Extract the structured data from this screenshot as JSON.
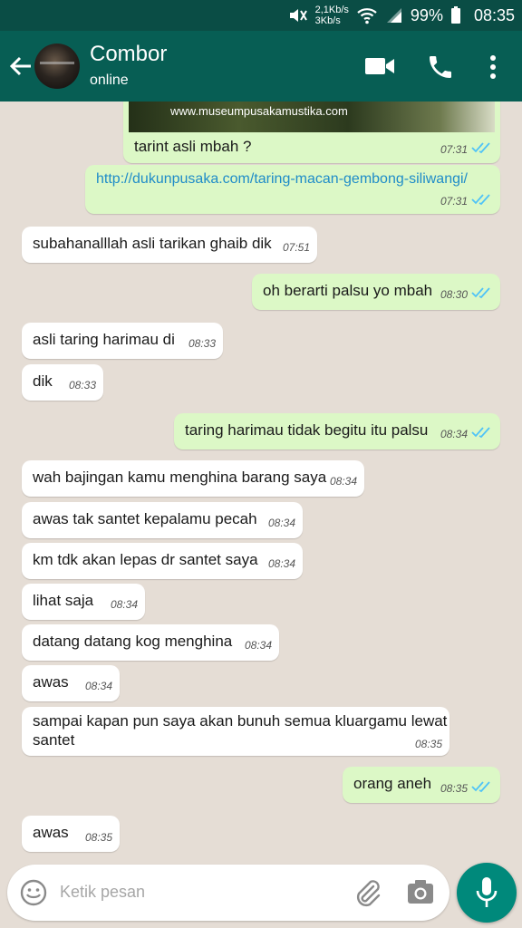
{
  "status_bar": {
    "net_up": "2,1Kb/s",
    "net_down": "3Kb/s",
    "battery": "99%",
    "time": "08:35"
  },
  "header": {
    "contact_name": "Combor",
    "contact_status": "online"
  },
  "image_preview": {
    "watermark": "www.museumpusakamustika.com"
  },
  "messages": [
    {
      "dir": "out",
      "text": "tarint asli mbah ?",
      "time": "07:31"
    },
    {
      "dir": "out",
      "text": "http://dukunpusaka.com/taring-macan-gembong-siliwangi/",
      "time": "07:31"
    },
    {
      "dir": "in",
      "text": "subahanalllah asli tarikan ghaib dik",
      "time": "07:51"
    },
    {
      "dir": "out",
      "text": "oh berarti palsu yo mbah",
      "time": "08:30"
    },
    {
      "dir": "in",
      "text": "asli taring harimau di",
      "time": "08:33"
    },
    {
      "dir": "in",
      "text": "dik",
      "time": "08:33"
    },
    {
      "dir": "out",
      "text": "taring harimau tidak begitu itu palsu",
      "time": "08:34"
    },
    {
      "dir": "in",
      "text": "wah bajingan kamu menghina barang saya",
      "time": "08:34"
    },
    {
      "dir": "in",
      "text": "awas tak santet kepalamu pecah",
      "time": "08:34"
    },
    {
      "dir": "in",
      "text": "km tdk akan lepas dr santet saya",
      "time": "08:34"
    },
    {
      "dir": "in",
      "text": "lihat saja",
      "time": "08:34"
    },
    {
      "dir": "in",
      "text": "datang datang kog menghina",
      "time": "08:34"
    },
    {
      "dir": "in",
      "text": "awas",
      "time": "08:34"
    },
    {
      "dir": "in",
      "text_line1": "sampai kapan pun saya akan bunuh semua kluargamu lewat",
      "text_line2": "santet",
      "time": "08:35"
    },
    {
      "dir": "out",
      "text": "orang aneh",
      "time": "08:35"
    },
    {
      "dir": "in",
      "text": "awas",
      "time": "08:35"
    }
  ],
  "input": {
    "placeholder": "Ketik pesan"
  },
  "colors": {
    "header": "#075e54",
    "status_bar": "#0a4d45",
    "outgoing": "#dcf8c6",
    "incoming": "#ffffff",
    "ticks": "#4fc3f7",
    "mic": "#00897b"
  }
}
